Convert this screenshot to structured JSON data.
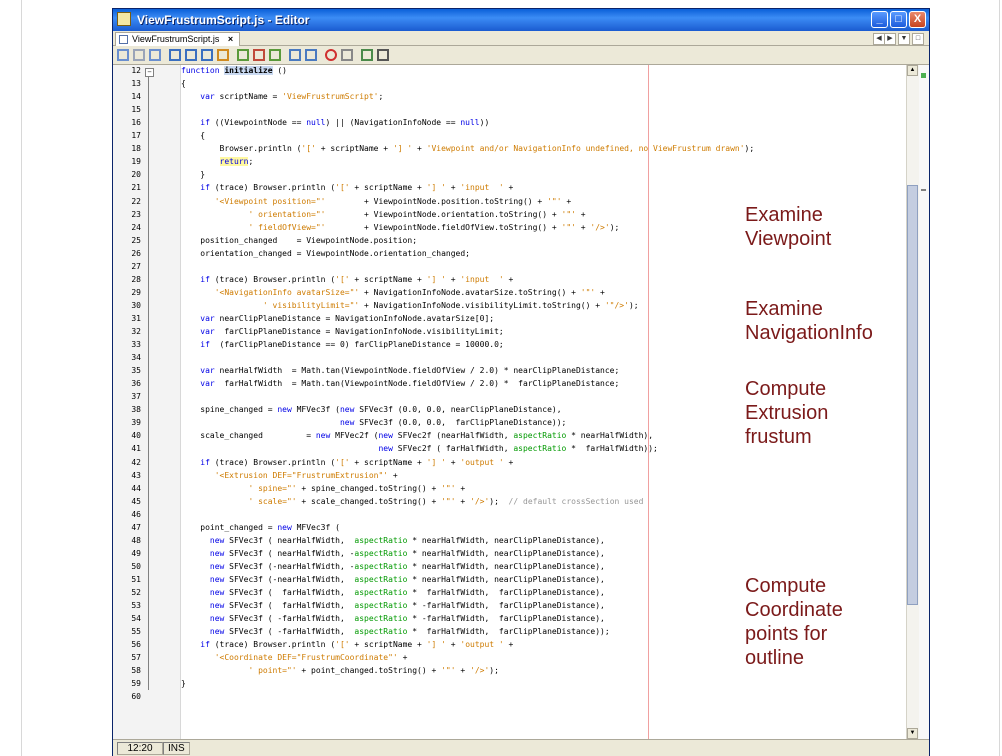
{
  "window": {
    "title": "ViewFrustrumScript.js - Editor",
    "minimize_label": "_",
    "maximize_label": "□",
    "close_label": "X"
  },
  "tab": {
    "label": "ViewFrustrumScript.js",
    "close_label": "×"
  },
  "tab_nav": {
    "left": "◀",
    "right": "▶",
    "menu": "▼",
    "restore": "□"
  },
  "toolbar": {
    "icons": [
      "back-icon",
      "history-icon",
      "forward-icon",
      "find-selection-icon",
      "find-previous-icon",
      "find-next-icon",
      "toggle-highlight-icon",
      "previous-bookmark-icon",
      "next-bookmark-icon",
      "toggle-bookmark-icon",
      "shift-left-icon",
      "shift-right-icon",
      "start-macro-icon",
      "stop-macro-icon",
      "comment-icon",
      "uncomment-icon"
    ]
  },
  "editor": {
    "line_numbers": [
      "12",
      "13",
      "14",
      "15",
      "16",
      "17",
      "18",
      "19",
      "20",
      "21",
      "22",
      "23",
      "24",
      "25",
      "26",
      "27",
      "28",
      "29",
      "30",
      "31",
      "32",
      "33",
      "34",
      "35",
      "36",
      "37",
      "38",
      "39",
      "40",
      "41",
      "42",
      "43",
      "44",
      "45",
      "46",
      "47",
      "48",
      "49",
      "50",
      "51",
      "52",
      "53",
      "54",
      "55",
      "56",
      "57",
      "58",
      "59",
      "60"
    ],
    "lines": [
      "function initialize ()",
      "{",
      "    var scriptName = 'ViewFrustrumScript';",
      "",
      "    if ((ViewpointNode == null) || (NavigationInfoNode == null))",
      "    {",
      "        Browser.println ('[' + scriptName + '] ' + 'Viewpoint and/or NavigationInfo undefined, no ViewFrustrum drawn');",
      "        return;",
      "    }",
      "    if (trace) Browser.println ('[' + scriptName + '] ' + 'input  ' +",
      "       '<Viewpoint position=\"'        + ViewpointNode.position.toString() + '\"' +",
      "              ' orientation=\"'        + ViewpointNode.orientation.toString() + '\"' +",
      "              ' fieldOfView=\"'        + ViewpointNode.fieldOfView.toString() + '\"' + '/>');",
      "    position_changed    = ViewpointNode.position;",
      "    orientation_changed = ViewpointNode.orientation_changed;",
      "",
      "    if (trace) Browser.println ('[' + scriptName + '] ' + 'input  ' +",
      "       '<NavigationInfo avatarSize=\"' + NavigationInfoNode.avatarSize.toString() + '\"' +",
      "                 ' visibilityLimit=\"' + NavigationInfoNode.visibilityLimit.toString() + '\"/>');",
      "    var nearClipPlaneDistance = NavigationInfoNode.avatarSize[0];",
      "    var  farClipPlaneDistance = NavigationInfoNode.visibilityLimit;",
      "    if  (farClipPlaneDistance == 0) farClipPlaneDistance = 10000.0;",
      "",
      "    var nearHalfWidth  = Math.tan(ViewpointNode.fieldOfView / 2.0) * nearClipPlaneDistance;",
      "    var  farHalfWidth  = Math.tan(ViewpointNode.fieldOfView / 2.0) *  farClipPlaneDistance;",
      "",
      "    spine_changed = new MFVec3f (new SFVec3f (0.0, 0.0, nearClipPlaneDistance),",
      "                                 new SFVec3f (0.0, 0.0,  farClipPlaneDistance));",
      "    scale_changed         = new MFVec2f (new SFVec2f (nearHalfWidth, aspectRatio * nearHalfWidth),",
      "                                         new SFVec2f ( farHalfWidth, aspectRatio *  farHalfWidth));",
      "    if (trace) Browser.println ('[' + scriptName + '] ' + 'output ' +",
      "       '<Extrusion DEF=\"FrustrumExtrusion\"' +",
      "              ' spine=\"' + spine_changed.toString() + '\"' +",
      "              ' scale=\"' + scale_changed.toString() + '\"' + '/>');  // default crossSection used",
      "",
      "    point_changed = new MFVec3f (",
      "      new SFVec3f ( nearHalfWidth,  aspectRatio * nearHalfWidth, nearClipPlaneDistance),",
      "      new SFVec3f ( nearHalfWidth, -aspectRatio * nearHalfWidth, nearClipPlaneDistance),",
      "      new SFVec3f (-nearHalfWidth, -aspectRatio * nearHalfWidth, nearClipPlaneDistance),",
      "      new SFVec3f (-nearHalfWidth,  aspectRatio * nearHalfWidth, nearClipPlaneDistance),",
      "      new SFVec3f (  farHalfWidth,  aspectRatio *  farHalfWidth,  farClipPlaneDistance),",
      "      new SFVec3f (  farHalfWidth,  aspectRatio * -farHalfWidth,  farClipPlaneDistance),",
      "      new SFVec3f ( -farHalfWidth,  aspectRatio * -farHalfWidth,  farClipPlaneDistance),",
      "      new SFVec3f ( -farHalfWidth,  aspectRatio *  farHalfWidth,  farClipPlaneDistance));",
      "    if (trace) Browser.println ('[' + scriptName + '] ' + 'output ' +",
      "       '<Coordinate DEF=\"FrustrumCoordinate\"' +",
      "              ' point=\"' + point_changed.toString() + '\"' + '/>');",
      "}",
      ""
    ]
  },
  "annotations": [
    {
      "text": "Examine\nViewpoint"
    },
    {
      "text": "Examine\nNavigationInfo"
    },
    {
      "text": "Compute\nExtrusion\nfrustum"
    },
    {
      "text": "Compute\nCoordinate\npoints for\noutline"
    }
  ],
  "status": {
    "position": "12:20",
    "mode": "INS"
  },
  "colors": {
    "titlebar": "#1a5bd0",
    "keyword": "#0000e6",
    "string": "#ce7b00",
    "comment": "#969696",
    "annotation": "#7b1a1a",
    "margin_line": "#f0a0a0"
  }
}
